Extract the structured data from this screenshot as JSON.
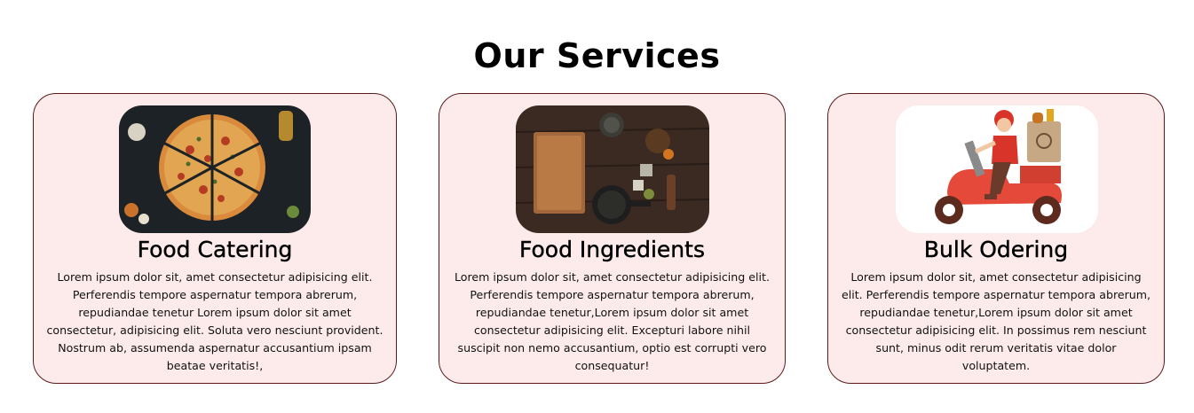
{
  "page": {
    "title": "Our Services"
  },
  "services": [
    {
      "heading": "Food Catering",
      "description": "Lorem ipsum dolor sit, amet consectetur adipisicing elit. Perferendis tempore aspernatur tempora abrerum, repudiandae tenetur Lorem ipsum dolor sit amet consectetur, adipisicing elit. Soluta vero nesciunt provident. Nostrum ab, assumenda aspernatur accusantium ipsam beatae veritatis!,",
      "image": "pizza-photo"
    },
    {
      "heading": "Food Ingredients",
      "description": "Lorem ipsum dolor sit, amet consectetur adipisicing elit. Perferendis tempore aspernatur tempora abrerum, repudiandae tenetur,Lorem ipsum dolor sit amet consectetur adipisicing elit. Excepturi labore nihil suscipit non nemo accusantium, optio est corrupti vero consequatur!",
      "image": "kitchen-ingredients-photo"
    },
    {
      "heading": "Bulk Odering",
      "description": "Lorem ipsum dolor sit, amet consectetur adipisicing elit. Perferendis tempore aspernatur tempora abrerum, repudiandae tenetur,Lorem ipsum dolor sit amet consectetur adipisicing elit. In possimus rem nesciunt sunt, minus odit rerum veritatis vitae dolor voluptatem.",
      "image": "delivery-scooter-illustration"
    }
  ],
  "colors": {
    "card_background": "#fdebeb",
    "card_border": "#5a1a1a"
  }
}
